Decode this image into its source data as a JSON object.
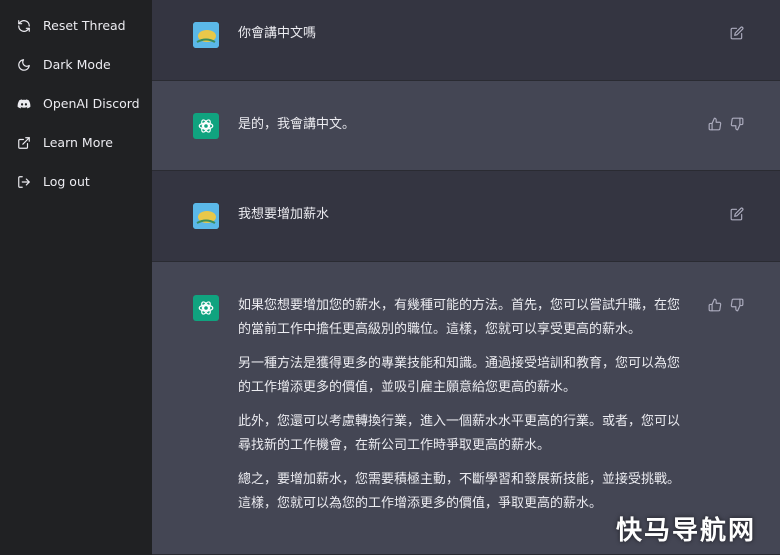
{
  "sidebar": {
    "items": [
      {
        "label": "Reset Thread",
        "icon": "refresh-icon"
      },
      {
        "label": "Dark Mode",
        "icon": "moon-icon"
      },
      {
        "label": "OpenAI Discord",
        "icon": "discord-icon"
      },
      {
        "label": "Learn More",
        "icon": "external-link-icon"
      },
      {
        "label": "Log out",
        "icon": "logout-icon"
      }
    ]
  },
  "thread": {
    "messages": [
      {
        "role": "user",
        "paragraphs": [
          "你會講中文嗎"
        ]
      },
      {
        "role": "assistant",
        "paragraphs": [
          "是的，我會講中文。"
        ]
      },
      {
        "role": "user",
        "paragraphs": [
          "我想要增加薪水"
        ]
      },
      {
        "role": "assistant",
        "paragraphs": [
          "如果您想要增加您的薪水，有幾種可能的方法。首先，您可以嘗試升職，在您的當前工作中擔任更高級別的職位。這樣，您就可以享受更高的薪水。",
          "另一種方法是獲得更多的專業技能和知識。通過接受培訓和教育，您可以為您的工作增添更多的價值，並吸引雇主願意給您更高的薪水。",
          "此外，您還可以考慮轉換行業，進入一個薪水水平更高的行業。或者，您可以尋找新的工作機會，在新公司工作時爭取更高的薪水。",
          "總之，要增加薪水，您需要積極主動，不斷學習和發展新技能，並接受挑戰。這樣，您就可以為您的工作增添更多的價值，爭取更高的薪水。"
        ]
      }
    ]
  },
  "watermark": "快马导航网",
  "colors": {
    "sidebar_bg": "#202123",
    "user_bg": "#343541",
    "bot_bg": "#444654",
    "accent": "#10a37f"
  }
}
